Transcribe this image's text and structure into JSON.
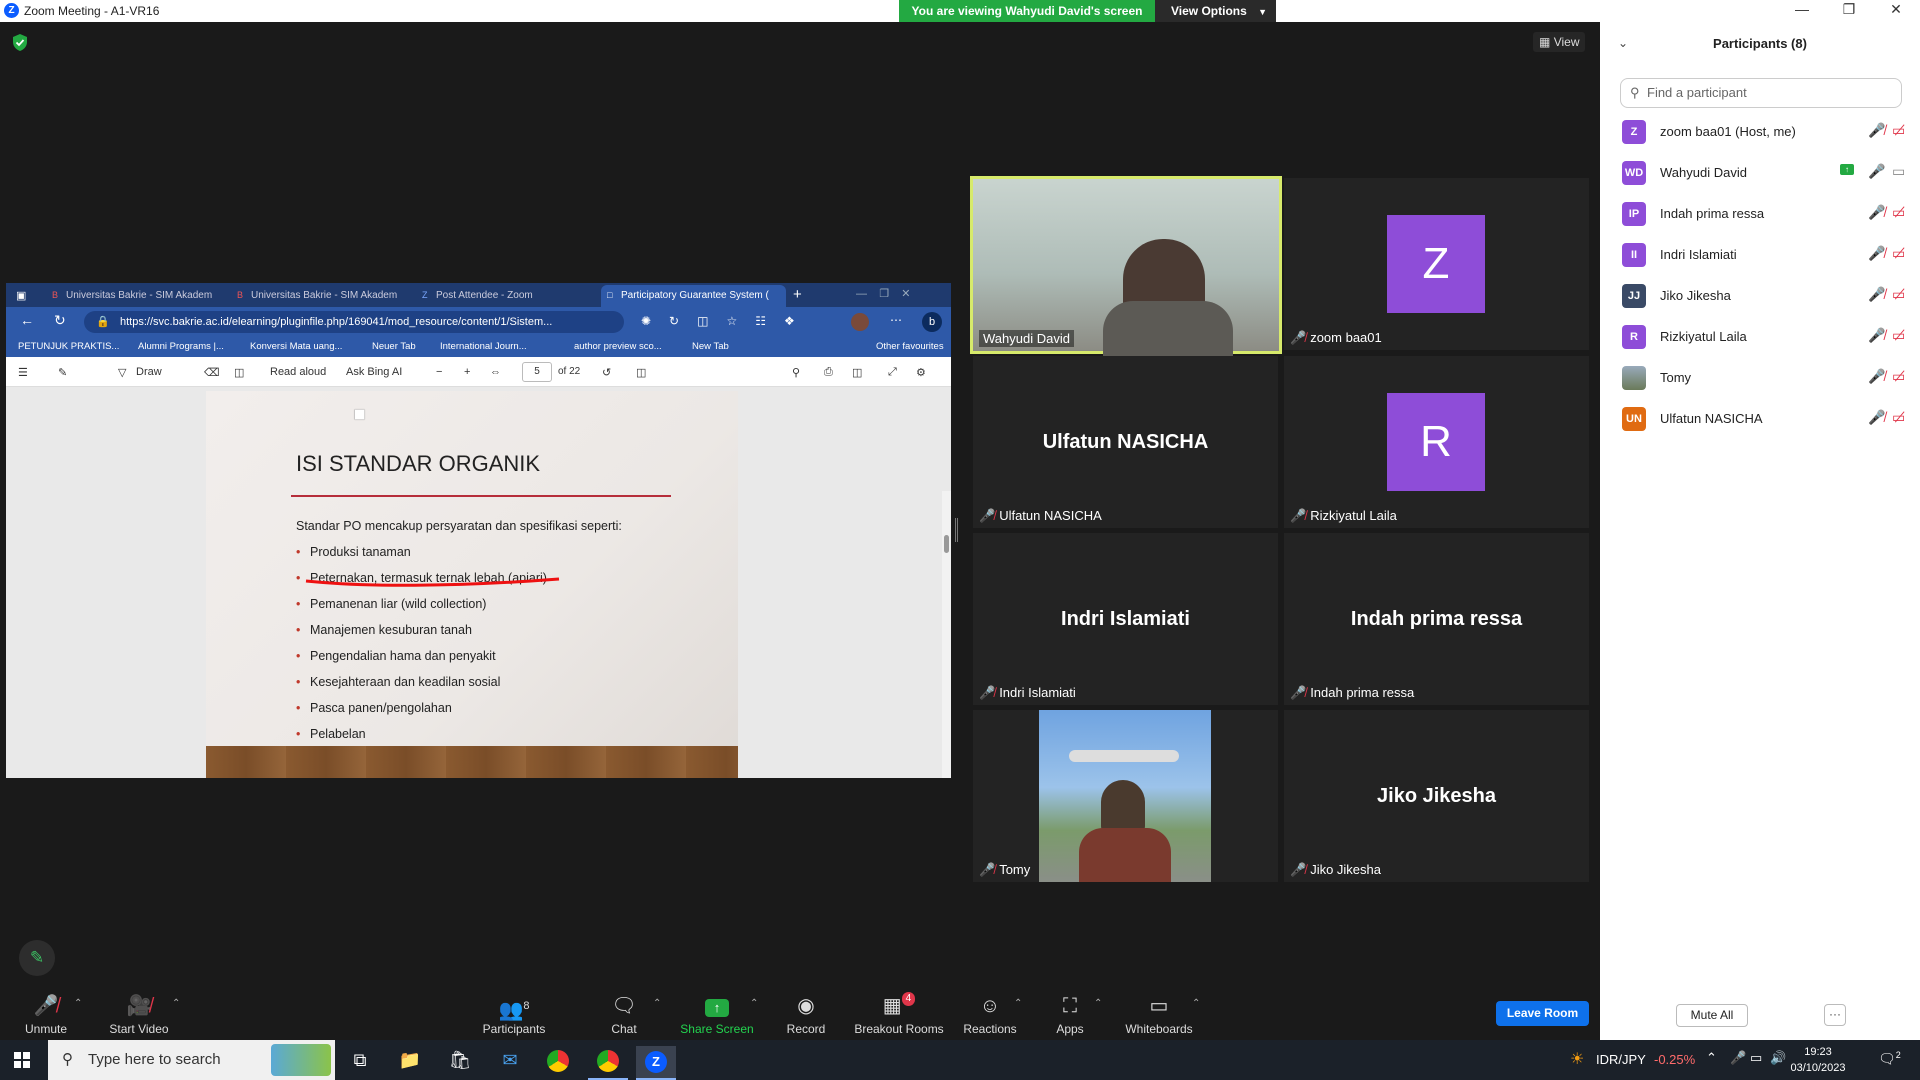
{
  "window": {
    "title": "Zoom Meeting - A1-VR16",
    "app_icon": "zoom-icon",
    "controls": [
      "minimize-icon",
      "restore-icon",
      "close-icon"
    ]
  },
  "share_banner": {
    "text": "You are viewing Wahyudi David's screen",
    "view_options": "View Options",
    "color": "#23a942"
  },
  "top_right": {
    "view_label": "View"
  },
  "shared_screen": {
    "tabs": [
      {
        "label": "Universitas Bakrie - SIM Akadem",
        "active": false
      },
      {
        "label": "Universitas Bakrie - SIM Akadem",
        "active": false
      },
      {
        "label": "Post Attendee - Zoom",
        "active": false
      },
      {
        "label": "Participatory Guarantee System (",
        "active": true
      }
    ],
    "url": "https://svc.bakrie.ac.id/elearning/pluginfile.php/169041/mod_resource/content/1/Sistem...",
    "bookmarks": [
      "PETUNJUK PRAKTIS...",
      "Alumni Programs |...",
      "Konversi Mata uang...",
      "Neuer Tab",
      "International Journ...",
      "author preview sco...",
      "New Tab",
      "Other favourites"
    ],
    "pdf_toolbar": {
      "draw": "Draw",
      "read_aloud": "Read aloud",
      "ask_bing": "Ask Bing AI",
      "page_current": "5",
      "page_total": "of 22"
    },
    "slide": {
      "title": "ISI STANDAR ORGANIK",
      "intro": "Standar PO mencakup persyaratan dan spesifikasi seperti:",
      "bullets": [
        "Produksi tanaman",
        "Peternakan, termasuk ternak lebah (apiari)",
        "Pemanenan liar (wild collection)",
        "Manajemen kesuburan tanah",
        "Pengendalian hama dan penyakit",
        "Kesejahteraan dan keadilan sosial",
        "Pasca panen/pengolahan",
        "Pelabelan"
      ]
    }
  },
  "video_tiles": [
    {
      "name": "Wahyudi David",
      "type": "video",
      "muted": false,
      "active_speaker": true
    },
    {
      "name": "zoom baa01",
      "type": "avatar",
      "letter": "Z",
      "muted": true
    },
    {
      "name": "Ulfatun NASICHA",
      "type": "name",
      "big": "Ulfatun NASICHA",
      "muted": true
    },
    {
      "name": "Rizkiyatul Laila",
      "type": "avatar",
      "letter": "R",
      "muted": true
    },
    {
      "name": "Indri Islamiati",
      "type": "name",
      "big": "Indri Islamiati",
      "muted": true
    },
    {
      "name": "Indah prima ressa",
      "type": "name",
      "big": "Indah prima ressa",
      "muted": true
    },
    {
      "name": "Tomy",
      "type": "photo",
      "muted": true
    },
    {
      "name": "Jiko Jikesha",
      "type": "name",
      "big": "Jiko Jikesha",
      "muted": true
    }
  ],
  "toolbar": {
    "unmute": "Unmute",
    "start_video": "Start Video",
    "participants": "Participants",
    "participants_count": "8",
    "chat": "Chat",
    "share_screen": "Share Screen",
    "record": "Record",
    "breakout_rooms": "Breakout Rooms",
    "breakout_badge": "4",
    "reactions": "Reactions",
    "apps": "Apps",
    "whiteboards": "Whiteboards",
    "leave": "Leave Room"
  },
  "participants_panel": {
    "title": "Participants (8)",
    "search_placeholder": "Find a participant",
    "participants": [
      {
        "initials": "Z",
        "name": "zoom baa01 (Host, me)",
        "color": "#8e4dd8",
        "mic": "muted",
        "cam": "off"
      },
      {
        "initials": "WD",
        "name": "Wahyudi David",
        "color": "#8e4dd8",
        "mic": "on",
        "cam": "on",
        "sharing": true
      },
      {
        "initials": "IP",
        "name": "Indah prima ressa",
        "color": "#8e4dd8",
        "mic": "muted",
        "cam": "off"
      },
      {
        "initials": "II",
        "name": "Indri Islamiati",
        "color": "#8e4dd8",
        "mic": "muted",
        "cam": "off"
      },
      {
        "initials": "JJ",
        "name": "Jiko Jikesha",
        "color": "#3a4a66",
        "mic": "muted",
        "cam": "off"
      },
      {
        "initials": "R",
        "name": "Rizkiyatul Laila",
        "color": "#8e4dd8",
        "mic": "muted",
        "cam": "off"
      },
      {
        "initials": "",
        "name": "Tomy",
        "color": "#6a8a6a",
        "mic": "muted",
        "cam": "off",
        "photo": true
      },
      {
        "initials": "UN",
        "name": "Ulfatun NASICHA",
        "color": "#e06b12",
        "mic": "muted",
        "cam": "off"
      }
    ],
    "mute_all": "Mute All",
    "more": "···"
  },
  "taskbar": {
    "search_placeholder": "Type here to search",
    "ticker": "IDR/JPY",
    "ticker_change": "-0.25%",
    "time": "19:23",
    "date": "03/10/2023",
    "notifications": "2"
  }
}
